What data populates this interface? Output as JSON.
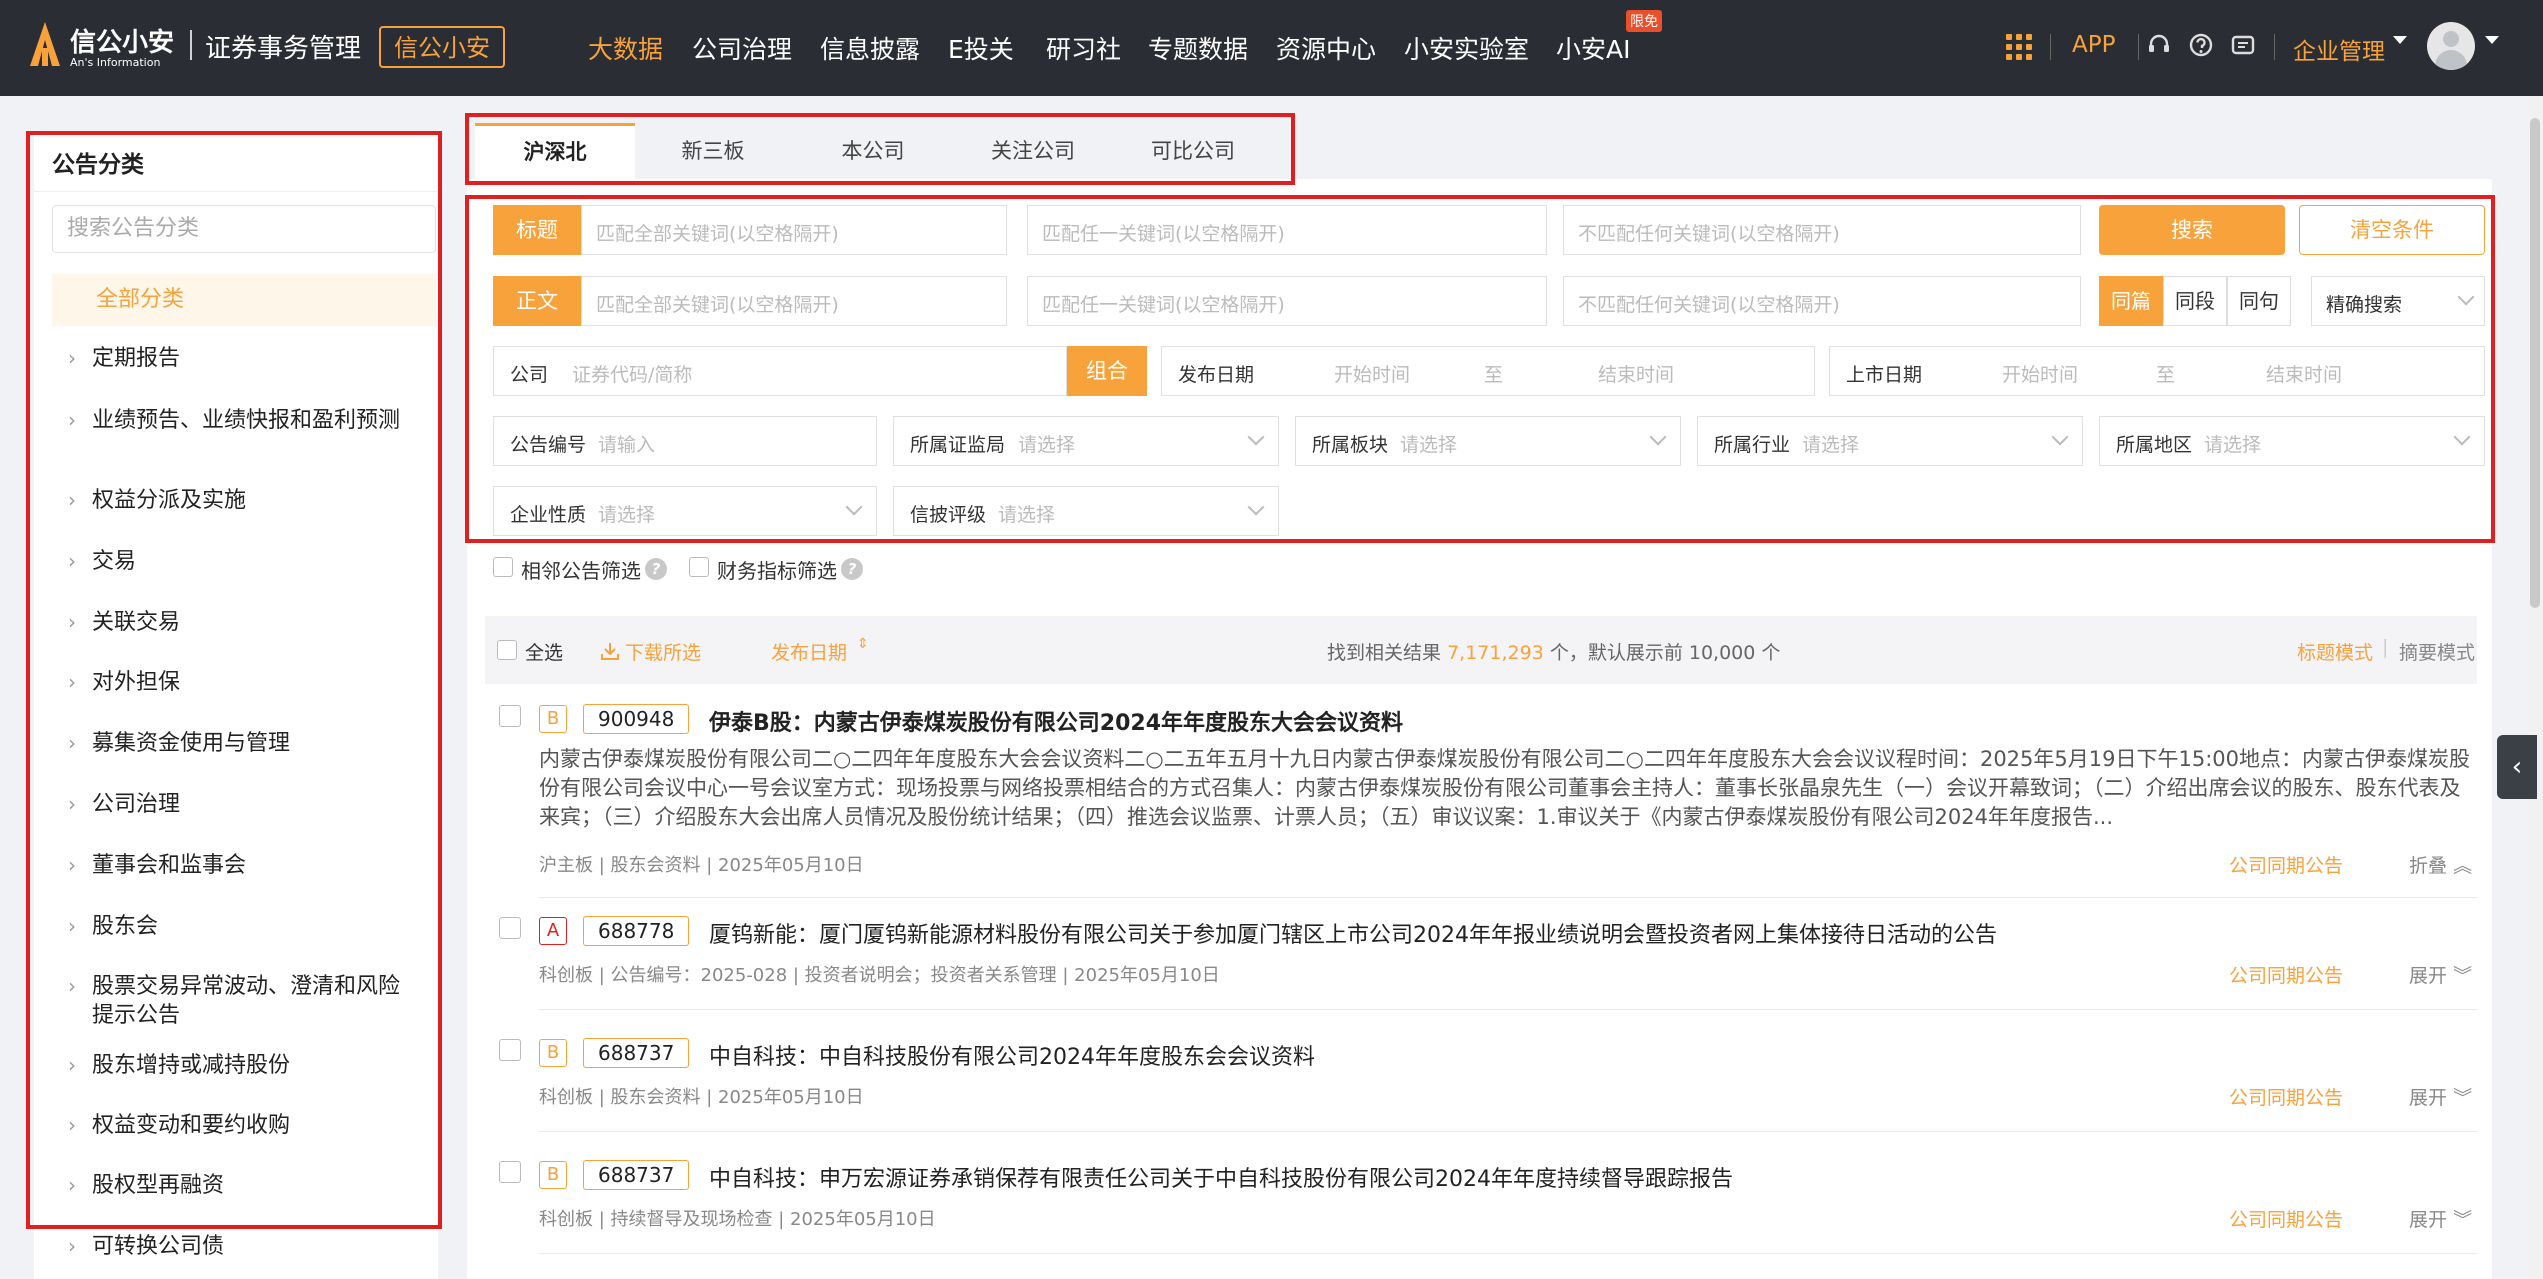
{
  "header": {
    "logo_cn": "信公小安",
    "logo_en": "An's Information",
    "system_title": "证券事务管理",
    "brand_button": "信公小安",
    "nav": [
      {
        "label": "大数据",
        "active": true
      },
      {
        "label": "公司治理"
      },
      {
        "label": "信息披露"
      },
      {
        "label": "E投关"
      },
      {
        "label": "研习社"
      },
      {
        "label": "专题数据"
      },
      {
        "label": "资源中心"
      },
      {
        "label": "小安实验室"
      },
      {
        "label": "小安AI"
      }
    ],
    "badge_free": "限免",
    "app_label": "APP",
    "enterprise_menu": "企业管理",
    "icons": [
      "grid-icon",
      "headset-icon",
      "help-icon",
      "message-icon",
      "avatar",
      "chevron-down-icon"
    ]
  },
  "sidebar": {
    "title": "公告分类",
    "search_placeholder": "搜索公告分类",
    "all_label": "全部分类",
    "items": [
      "定期报告",
      "业绩预告、业绩快报和盈利预测",
      "权益分派及实施",
      "交易",
      "关联交易",
      "对外担保",
      "募集资金使用与管理",
      "公司治理",
      "董事会和监事会",
      "股东会",
      "股票交易异常波动、澄清和风险提示公告",
      "股东增持或减持股份",
      "权益变动和要约收购",
      "股权型再融资",
      "可转换公司债"
    ]
  },
  "tabs": [
    "沪深北",
    "新三板",
    "本公司",
    "关注公司",
    "可比公司"
  ],
  "filters": {
    "title_tag": "标题",
    "body_tag": "正文",
    "kw_all": "匹配全部关键词(以空格隔开)",
    "kw_any": "匹配任一关键词(以空格隔开)",
    "kw_none": "不匹配任何关键词(以空格隔开)",
    "search_btn": "搜索",
    "clear_btn": "清空条件",
    "scope": [
      "同篇",
      "同段",
      "同句"
    ],
    "precision": "精确搜索",
    "company_label": "公司",
    "company_placeholder": "证券代码/简称",
    "combo_btn": "组合",
    "publish_date_label": "发布日期",
    "listing_date_label": "上市日期",
    "start_time": "开始时间",
    "to": "至",
    "end_time": "结束时间",
    "notice_no_label": "公告编号",
    "notice_no_placeholder": "请输入",
    "regulator_label": "所属证监局",
    "board_label": "所属板块",
    "industry_label": "所属行业",
    "region_label": "所属地区",
    "nature_label": "企业性质",
    "rating_label": "信披评级",
    "select_placeholder": "请选择",
    "adjacent_filter": "相邻公告筛选",
    "financial_filter": "财务指标筛选"
  },
  "results": {
    "select_all": "全选",
    "download": "下载所选",
    "sort_label": "发布日期",
    "found_prefix": "找到相关结果",
    "count": "7,171,293",
    "found_suffix": "个，默认展示前 10,000 个",
    "mode_title": "标题模式",
    "mode_summary": "摘要模式",
    "items": [
      {
        "grade": "B",
        "code": "900948",
        "title": "伊泰B股：内蒙古伊泰煤炭股份有限公司2024年年度股东大会会议资料",
        "summary": "内蒙古伊泰煤炭股份有限公司二○二四年年度股东大会会议资料二○二五年五月十九日内蒙古伊泰煤炭股份有限公司二○二四年年度股东大会会议议程时间：2025年5月19日下午15:00地点：内蒙古伊泰煤炭股份有限公司会议中心一号会议室方式：现场投票与网络投票相结合的方式召集人：内蒙古伊泰煤炭股份有限公司董事会主持人：董事长张晶泉先生（一）会议开幕致词；（二）介绍出席会议的股东、股东代表及来宾；（三）介绍股东大会出席人员情况及股份统计结果；（四）推选会议监票、计票人员；（五）审议议案：1.审议关于《内蒙古伊泰煤炭股份有限公司2024年年度报告...",
        "meta": "沪主板 | 股东会资料 | 2025年05月10日",
        "link": "公司同期公告",
        "fold": "折叠"
      },
      {
        "grade": "A",
        "code": "688778",
        "title": "厦钨新能：厦门厦钨新能源材料股份有限公司关于参加厦门辖区上市公司2024年年报业绩说明会暨投资者网上集体接待日活动的公告",
        "meta": "科创板 | 公告编号：2025-028 | 投资者说明会；投资者关系管理 | 2025年05月10日",
        "link": "公司同期公告",
        "fold": "展开"
      },
      {
        "grade": "B",
        "code": "688737",
        "title": "中自科技：中自科技股份有限公司2024年年度股东会会议资料",
        "meta": "科创板 | 股东会资料 | 2025年05月10日",
        "link": "公司同期公告",
        "fold": "展开"
      },
      {
        "grade": "B",
        "code": "688737",
        "title": "中自科技：申万宏源证券承销保荐有限责任公司关于中自科技股份有限公司2024年年度持续督导跟踪报告",
        "meta": "科创板 | 持续督导及现场检查 | 2025年05月10日",
        "link": "公司同期公告",
        "fold": "展开"
      }
    ]
  },
  "colors": {
    "accent": "#f7a23b",
    "topbar": "#2a2d33",
    "highlight_box": "#e02020"
  }
}
